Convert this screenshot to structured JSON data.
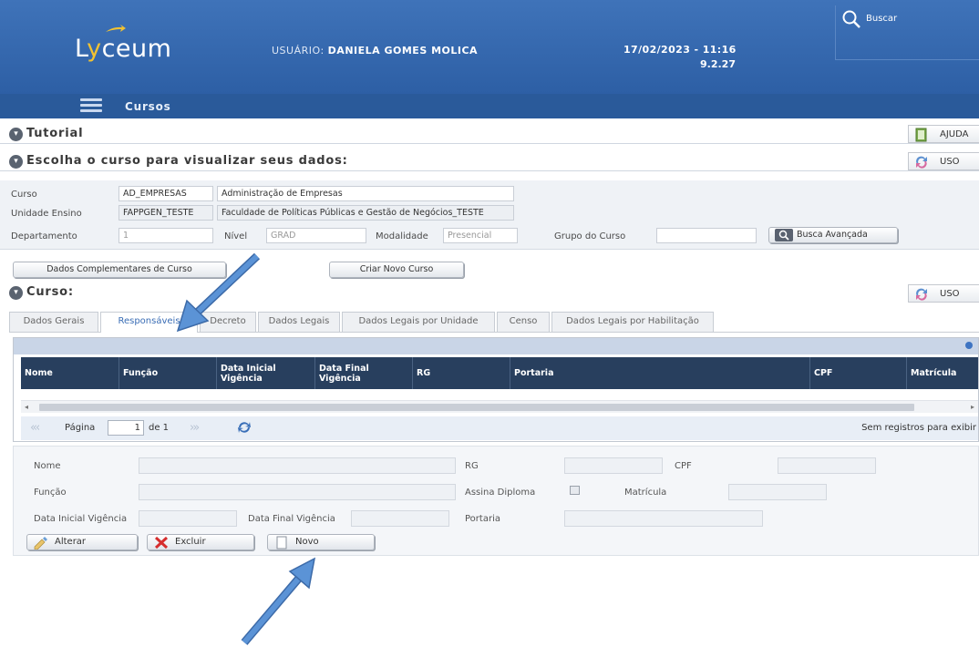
{
  "header": {
    "logo": "Lyceum",
    "user_prefix": "USUÁRIO:",
    "user_name": "DANIELA GOMES MOLICA",
    "datetime": "17/02/2023 - 11:16",
    "version": "9.2.27",
    "search_label": "Buscar"
  },
  "nav": {
    "title": "Cursos"
  },
  "tutorial": {
    "title": "Tutorial",
    "help_label": "AJUDA"
  },
  "choose": {
    "title": "Escolha o curso para visualizar seus dados:",
    "uso_label": "USO"
  },
  "course_form": {
    "curso_label": "Curso",
    "curso_code": "AD_EMPRESAS",
    "curso_name": "Administração de Empresas",
    "unidade_label": "Unidade Ensino",
    "unidade_code": "FAPPGEN_TESTE",
    "unidade_name": "Faculdade de Políticas Públicas e Gestão de Negócios_TESTE",
    "departamento_label": "Departamento",
    "departamento_value": "1",
    "nivel_label": "Nível",
    "nivel_value": "GRAD",
    "modalidade_label": "Modalidade",
    "modalidade_value": "Presencial",
    "grupo_label": "Grupo do Curso",
    "grupo_value": "",
    "busca_button": "Busca Avançada",
    "dados_button": "Dados Complementares de Curso",
    "criar_button": "Criar Novo Curso"
  },
  "curso_section": {
    "title": "Curso:",
    "uso_label": "USO"
  },
  "tabs": [
    "Dados Gerais",
    "Responsáveis",
    "Decreto",
    "Dados Legais",
    "Dados Legais por Unidade",
    "Censo",
    "Dados Legais por Habilitação"
  ],
  "grid": {
    "columns": [
      "Nome",
      "Função",
      "Data Inicial Vigência",
      "Data Final Vigência",
      "RG",
      "Portaria",
      "CPF",
      "Matrícula"
    ],
    "pager_label": "Página",
    "page_value": "1",
    "page_of": "de 1",
    "empty_text": "Sem registros para exibir"
  },
  "detail": {
    "nome_label": "Nome",
    "rg_label": "RG",
    "cpf_label": "CPF",
    "funcao_label": "Função",
    "assina_label": "Assina Diploma",
    "matricula_label": "Matrícula",
    "data_inicial_label": "Data Inicial Vigência",
    "data_final_label": "Data Final Vigência",
    "portaria_label": "Portaria",
    "alterar_button": "Alterar",
    "excluir_button": "Excluir",
    "novo_button": "Novo"
  },
  "colors": {
    "header_blue": "#2d5fa5",
    "nav_blue": "#2a5a9a",
    "grid_header": "#283f5e",
    "annotation_arrow": "#4f86c9"
  }
}
